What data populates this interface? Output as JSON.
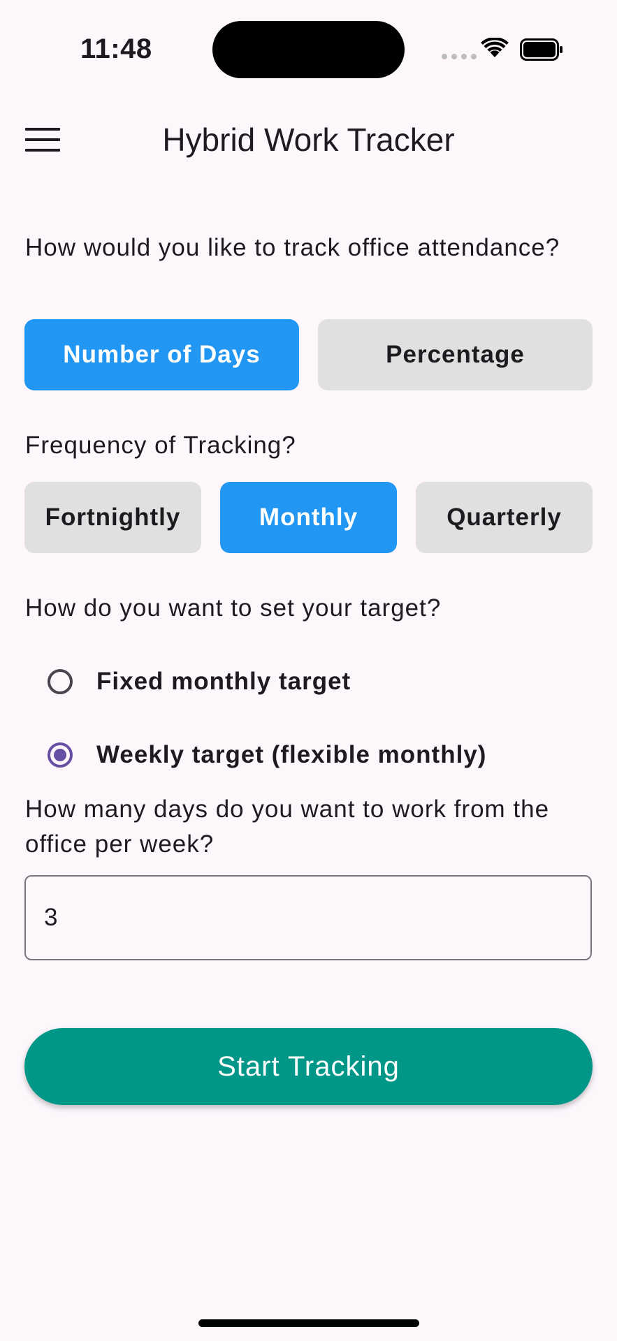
{
  "status_bar": {
    "time": "11:48",
    "icons": [
      "signal-dots-icon",
      "wifi-icon",
      "battery-icon"
    ]
  },
  "app_bar": {
    "title": "Hybrid Work Tracker",
    "menu_icon": "hamburger-menu-icon"
  },
  "tracking_mode": {
    "question": "How would you like to track office attendance?",
    "options": [
      {
        "label": "Number of Days",
        "selected": true
      },
      {
        "label": "Percentage",
        "selected": false
      }
    ]
  },
  "frequency": {
    "question": "Frequency of Tracking?",
    "options": [
      {
        "label": "Fortnightly",
        "selected": false
      },
      {
        "label": "Monthly",
        "selected": true
      },
      {
        "label": "Quarterly",
        "selected": false
      }
    ]
  },
  "target_type": {
    "question": "How do you want to set your target?",
    "options": [
      {
        "label": "Fixed monthly target",
        "selected": false
      },
      {
        "label": "Weekly target (flexible monthly)",
        "selected": true
      }
    ]
  },
  "days_per_week": {
    "question": "How many days do you want to work from the office per week?",
    "value": "3"
  },
  "start_button": {
    "label": "Start Tracking"
  },
  "colors": {
    "background": "#fdf7fc",
    "selected_segment": "#2196f3",
    "unselected_segment": "#e0e0e0",
    "radio_accent": "#6750a4",
    "primary_button": "#009688"
  }
}
